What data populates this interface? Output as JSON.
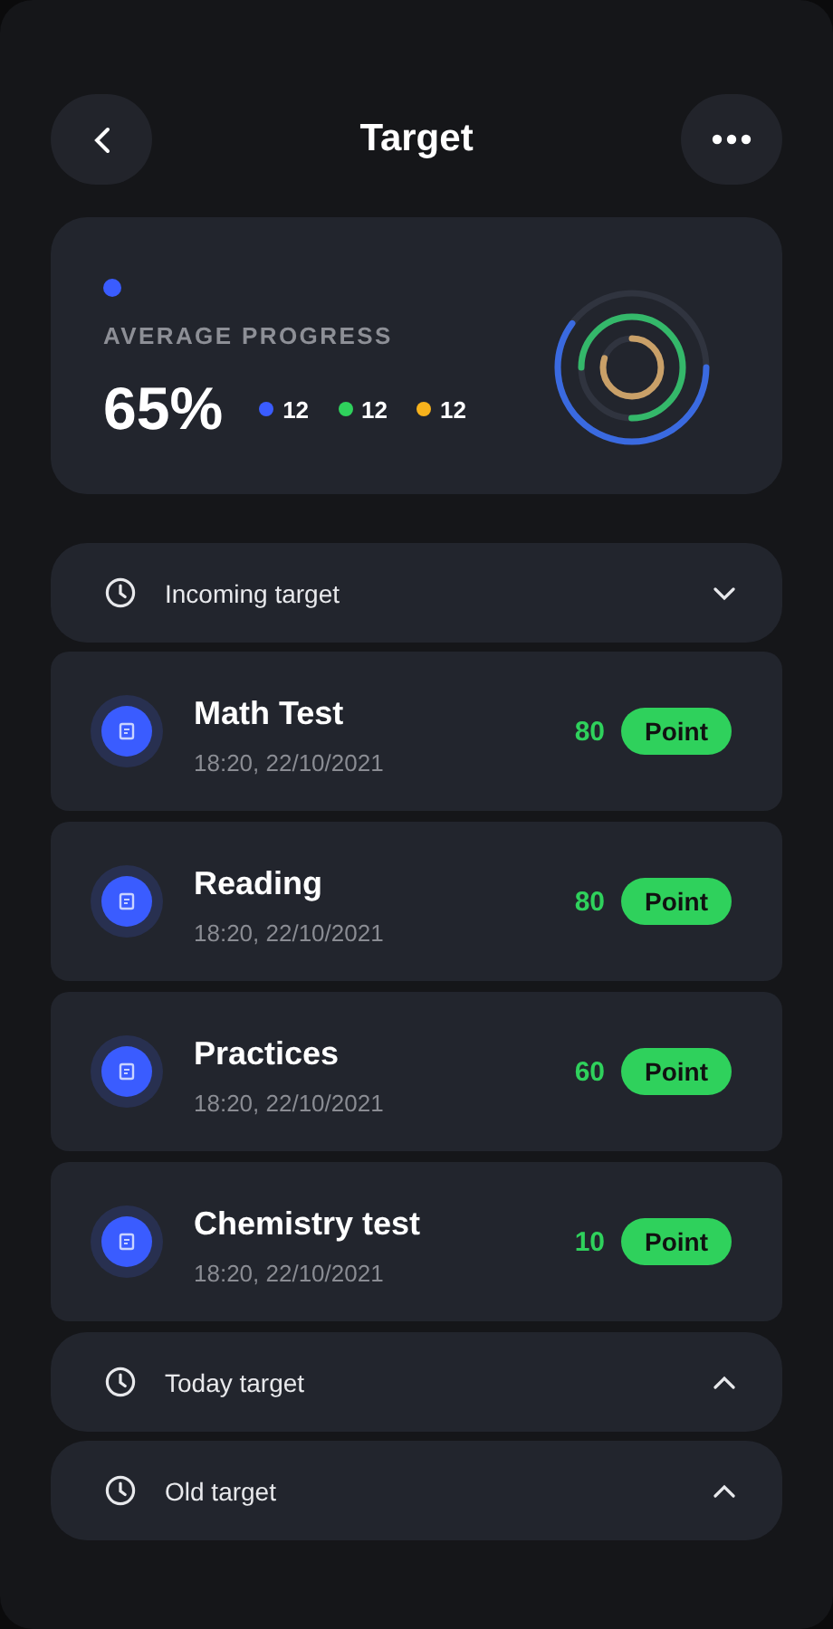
{
  "header": {
    "title": "Target"
  },
  "progress": {
    "label": "AVERAGE PROGRESS",
    "value": "65%",
    "legend": [
      {
        "color": "#3a5cff",
        "count": "12"
      },
      {
        "color": "#2fd15c",
        "count": "12"
      },
      {
        "color": "#f7b21c",
        "count": "12"
      }
    ]
  },
  "sections": [
    {
      "label": "Incoming target",
      "expanded": true,
      "items": [
        {
          "title": "Math Test",
          "time": "18:20, 22/10/2021",
          "score": "80",
          "badge": "Point"
        },
        {
          "title": "Reading",
          "time": "18:20, 22/10/2021",
          "score": "80",
          "badge": "Point"
        },
        {
          "title": "Practices",
          "time": "18:20, 22/10/2021",
          "score": "60",
          "badge": "Point"
        },
        {
          "title": "Chemistry test",
          "time": "18:20, 22/10/2021",
          "score": "10",
          "badge": "Point"
        }
      ]
    },
    {
      "label": "Today target",
      "expanded": false
    },
    {
      "label": "Old target",
      "expanded": false
    }
  ]
}
